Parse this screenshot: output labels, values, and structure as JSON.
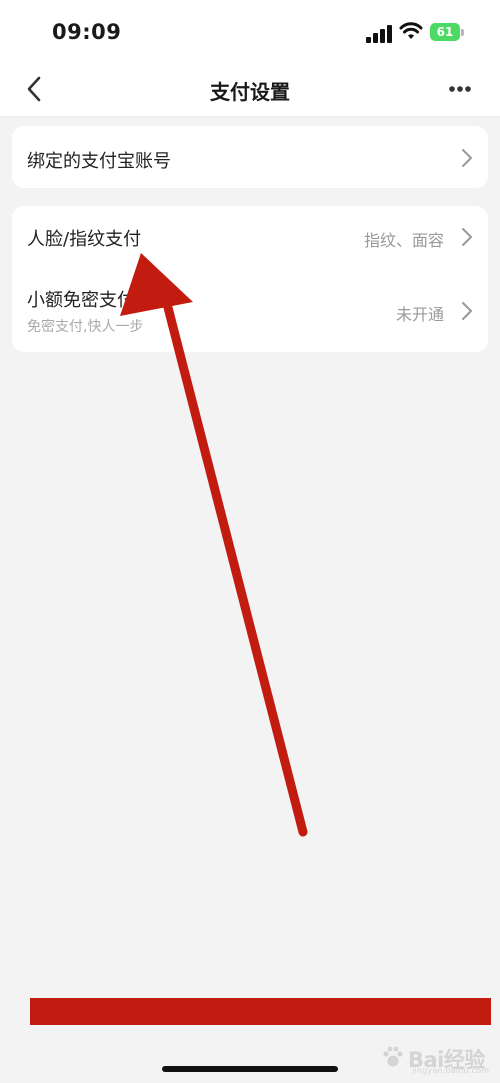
{
  "status_bar": {
    "time": "09:09",
    "battery": "61"
  },
  "navbar": {
    "title": "支付设置",
    "back_icon": "chevron-left-icon",
    "more_icon": "more-icon"
  },
  "settings": {
    "bound_account": {
      "label": "绑定的支付宝账号"
    },
    "face_fingerprint": {
      "label": "人脸/指纹支付",
      "value": "指纹、面容"
    },
    "small_amount": {
      "label": "小额免密支付",
      "subtitle": "免密支付,快人一步",
      "value": "未开通"
    }
  },
  "watermark": {
    "text": "Bai经验",
    "sub": "jingyan.baidu.com"
  },
  "annotation": {
    "arrow_color": "#c21c10"
  }
}
